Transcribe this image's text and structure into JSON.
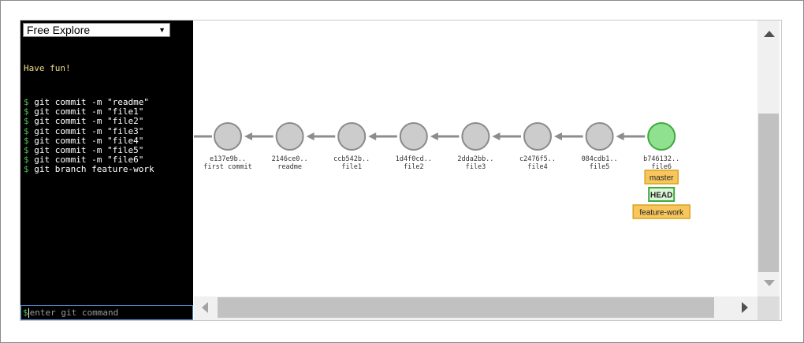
{
  "mode_select": {
    "value": "Free Explore"
  },
  "terminal": {
    "greeting": "Have fun!",
    "prompt_symbol": "$",
    "history": [
      "git commit -m \"readme\"",
      "git commit -m \"file1\"",
      "git commit -m \"file2\"",
      "git commit -m \"file3\"",
      "git commit -m \"file4\"",
      "git commit -m \"file5\"",
      "git commit -m \"file6\"",
      "git branch feature-work"
    ],
    "input": {
      "placeholder": "enter git command",
      "value": ""
    }
  },
  "graph": {
    "commits": [
      {
        "id": "e137e9b..",
        "message": "first commit"
      },
      {
        "id": "2146ce0..",
        "message": "readme"
      },
      {
        "id": "ccb542b..",
        "message": "file1"
      },
      {
        "id": "1d4f0cd..",
        "message": "file2"
      },
      {
        "id": "2dda2bb..",
        "message": "file3"
      },
      {
        "id": "c2476f5..",
        "message": "file4"
      },
      {
        "id": "084cdb1..",
        "message": "file5"
      },
      {
        "id": "b746132..",
        "message": "file6",
        "is_head": true
      }
    ],
    "refs": [
      {
        "name": "master",
        "kind": "branch"
      },
      {
        "name": "HEAD",
        "kind": "head"
      },
      {
        "name": "feature-work",
        "kind": "branch"
      }
    ]
  },
  "colors": {
    "commit_fill": "#cccccc",
    "commit_stroke": "#8a8a8a",
    "head_commit_fill": "#8fe08f",
    "head_commit_stroke": "#3fa83f",
    "branch_tag_fill": "#f7c75e",
    "branch_tag_stroke": "#d9a21e",
    "head_tag_fill": "#dcf7d7",
    "head_tag_stroke": "#3fa83f",
    "arrow": "#8c8c8c",
    "prompt": "#4fbf4f"
  }
}
